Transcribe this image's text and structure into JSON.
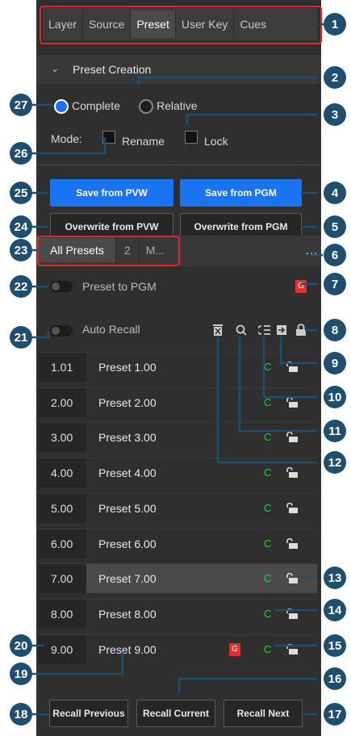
{
  "tabs": [
    "Layer",
    "Source",
    "Preset",
    "User Key",
    "Cues"
  ],
  "active_tab": "Preset",
  "section_title": "Preset Creation",
  "mode_options": {
    "complete": "Complete",
    "relative": "Relative"
  },
  "mode_label": "Mode:",
  "rename_label": "Rename",
  "lock_label": "Lock",
  "buttons": {
    "save_pvw": "Save from PVW",
    "save_pgm": "Save from PGM",
    "overwrite_pvw": "Overwrite from PVW",
    "overwrite_pgm": "Overwrite from PGM",
    "recall_previous": "Recall Previous",
    "recall_current": "Recall Current",
    "recall_next": "Recall Next"
  },
  "preset_tabs": [
    "All Presets",
    "2",
    "M..."
  ],
  "more_icon": "…",
  "preset_to_pgm": "Preset to PGM",
  "auto_recall": "Auto Recall",
  "badge_g": "G",
  "column_c": "C",
  "presets": [
    {
      "num": "1.01",
      "name": "Preset 1.00"
    },
    {
      "num": "2.00",
      "name": "Preset 2.00"
    },
    {
      "num": "3.00",
      "name": "Preset 3.00"
    },
    {
      "num": "4.00",
      "name": "Preset 4.00"
    },
    {
      "num": "5.00",
      "name": "Preset 5.00"
    },
    {
      "num": "6.00",
      "name": "Preset 6.00"
    },
    {
      "num": "7.00",
      "name": "Preset 7.00"
    },
    {
      "num": "8.00",
      "name": "Preset 8.00"
    },
    {
      "num": "9.00",
      "name": "Preset 9.00"
    }
  ],
  "callouts": [
    "1",
    "2",
    "3",
    "4",
    "5",
    "6",
    "7",
    "8",
    "9",
    "10",
    "11",
    "12",
    "13",
    "14",
    "15",
    "16",
    "17",
    "18",
    "19",
    "20",
    "21",
    "22",
    "23",
    "24",
    "25",
    "26",
    "27"
  ],
  "colors": {
    "accent": "#1a73f0",
    "callout": "#1f4e6e",
    "highlight": "#e4232a",
    "green": "#2ecc40"
  }
}
